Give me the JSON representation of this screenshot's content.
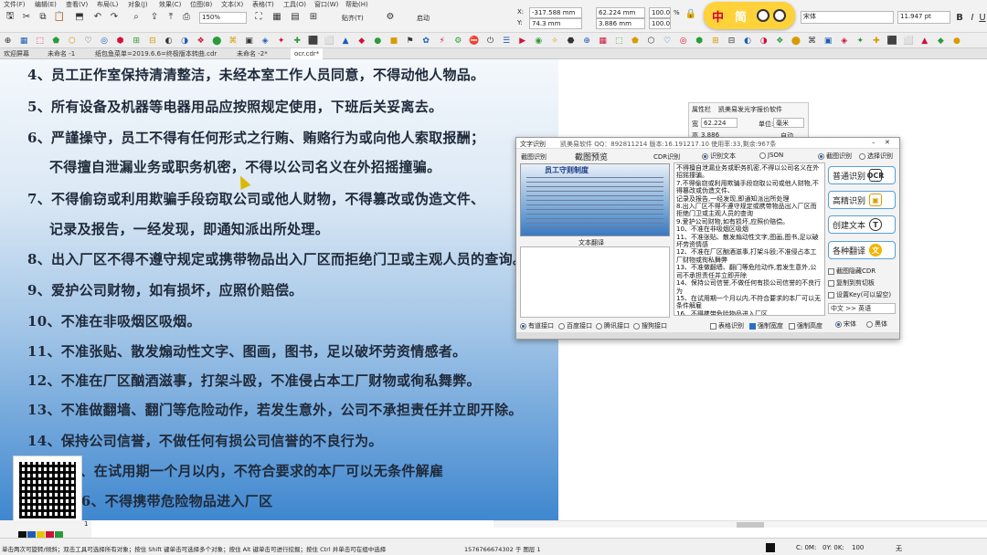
{
  "toolbar": {
    "menus": [
      "文件(F)",
      "编辑(E)",
      "查看(V)",
      "布局(L)",
      "对象(J)",
      "效果(C)",
      "位图(B)",
      "文本(X)",
      "表格(T)",
      "工具(O)",
      "窗口(W)",
      "帮助(H)"
    ],
    "zoom": "150%",
    "snap_label": "贴齐(T)",
    "auto_label": "启动",
    "x_label": "X:",
    "x_value": "-317.588 mm",
    "y_label": "Y:",
    "y_value": "74.3 mm",
    "w_value": "62.224 mm",
    "h_value": "3.886 mm",
    "scale_w": "100.0",
    "scale_h": "100.0",
    "pct": "%",
    "font_name": "宋体",
    "font_size": "11.947 pt"
  },
  "yellow_widget": {
    "text1": "中",
    "text2": "简"
  },
  "tabs": [
    "欢迎屏幕",
    "未命名 -1",
    "纸包鱼菜单=2019.6.6=终极版本转曲.cdr",
    "未命名 -2*",
    "ocr.cdr*"
  ],
  "document": {
    "lines": [
      "4、员工正作室保持清清整洁，未经本室工作人员同意，不得动他人物品。",
      "5、所有设备及机器等电器用品应按照规定使用，下班后关妥离去。",
      "6、严謹操守，员工不得有任何形式之行贿、贿赂行为或向他人索取报酬；",
      "不得擅自泄漏业务或职务机密，不得以公司名义在外招摇撞骗。",
      "7、不得偷窃或利用欺骗手段窃取公司或他人财物，不得篡改或伪造文件、",
      "记录及报告，一经发现，即通知派出所处理。",
      "8、出入厂区不得不遵守规定或携带物品出入厂区而拒绝门卫或主观人员的查询。",
      "9、爱护公司财物，如有损坏，应照价赔偿。",
      "10、不准在非吸烟区吸烟。",
      "11、不准张贴、散发煽动性文字、图画，图书，足以破坏劳资情感者。",
      "12、不准在厂区酗酒滋事，打架斗殴，不准侵占本工厂财物或徇私舞弊。",
      "13、不准做翻墙、翻门等危险动作，若发生意外，公司不承担责任并立即开除。",
      "14、保持公司信誉，不做任何有损公司信誉的不良行为。",
      "15、在试用期一个月以内，不符合要求的本厂可以无条件解雇",
      "16、不得携带危险物品进入厂区"
    ],
    "page_number": "1"
  },
  "properties_panel": {
    "title": "属性栏",
    "subtitle": "凯美易发光字报价软件",
    "w_label": "宽",
    "w_value": "62.224",
    "h_label": "高",
    "h_value": "3.886",
    "unit_label": "单位:",
    "unit_value": "毫米",
    "auto_label": "自动"
  },
  "ocr_dialog": {
    "title": "文字识别",
    "title_extra": "凯美易软件 QQ：892811214 版本:16.191217.10 使用率:33,剩余:967条",
    "tab_capture": "截图识别",
    "tab_preview": "截图预览",
    "tab_cdr": "CDR识别",
    "opt_recognize_text": "识别文本",
    "opt_json": "JSON",
    "preview_heading": "员工守则制度",
    "translate_label": "文本翻译",
    "ocr_text": "不得擅自泄漏业务或职务机密,不得以公司名义在外招摇撞骗。\n7.不得偷窃或利用欺骗手段窃取公司或他人财物,不得篡改或伪造文件、\n记录及报告,一经发现,即通知派出所处理\n8.出入厂区不得不遵守规定或携带物品出入厂区而拒绝门卫或主观人员的查询\n9.爱护公司财物,如有损坏,应照价赔偿。\n10、不准在非吸烟区吸烟\n11、不准张贴、散发煽动性文字,图画,图书,足以破坏劳资情感\n12、不准在厂区酗酒滋事,打架斗殴;不准侵占本工厂财物或徇私舞弊\n13、不准做翻墙、翻门等危险动作,若发生意外,公司不承担责任并立即开除\n14、保持公司信誉,不做任何有损公司信誉的不良行为\n15、在试用期一个月以内,不符合要求的本厂可以无条件解雇\n16、不得携带危险物品进入厂区",
    "mode_capture": "截图识别",
    "mode_select": "选择识别",
    "btn_normal": "普通识别",
    "btn_hd": "高精识别",
    "btn_create": "创建文本",
    "btn_translate": "各种翻译",
    "chk_capture_hide": "截图隐藏CDR",
    "chk_copy_clipboard": "复制到剪切板",
    "chk_set_key": "设置Key(可以留空)",
    "lang_select": "中文 >> 英语",
    "font_song": "宋体",
    "font_hei": "黑体",
    "api_youdao": "有道接口",
    "api_baidu": "百度接口",
    "api_tencent": "腾讯接口",
    "api_sogou": "搜狗接口",
    "chk_table": "表格识别",
    "chk_force_width": "强制宽度",
    "chk_force_height": "强制高度"
  },
  "status": {
    "hint": "单击两次可旋转/倾斜；双击工具可选择所有对象；按住 Shift 键单击可选择多个对象；按住 Alt 键单击可进行挖掘；按住 Ctrl 并单击可在组中选择",
    "object_info": "1576766674302 于 图层 1",
    "fill_c": "C: 0M:",
    "fill_y": "0Y: 0K:",
    "fill_k": "100",
    "no_outline": "无"
  },
  "colors": {
    "accent": "#2a6fc9",
    "dialog_border": "#57a0d8",
    "yellow": "#ffd23a"
  }
}
